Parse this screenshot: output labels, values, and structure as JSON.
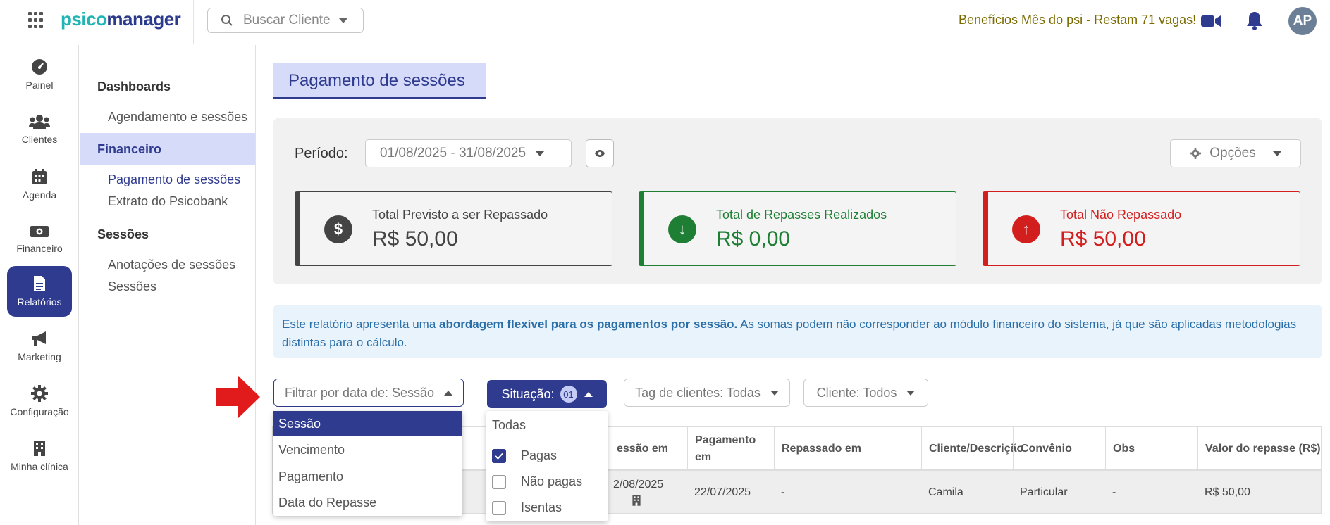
{
  "header": {
    "logo_part1": "psico",
    "logo_part2": "manager",
    "search_placeholder": "Buscar Cliente",
    "promo_text": "Benefícios Mês do psi - Restam 71 vagas!",
    "avatar_initials": "AP"
  },
  "left_nav": {
    "items": [
      {
        "label": "Painel",
        "icon": "gauge-icon"
      },
      {
        "label": "Clientes",
        "icon": "users-icon"
      },
      {
        "label": "Agenda",
        "icon": "calendar-icon"
      },
      {
        "label": "Financeiro",
        "icon": "money-icon"
      },
      {
        "label": "Relatórios",
        "icon": "report-icon"
      },
      {
        "label": "Marketing",
        "icon": "megaphone-icon"
      },
      {
        "label": "Configuração",
        "icon": "gear-icon"
      },
      {
        "label": "Minha clínica",
        "icon": "building-icon"
      }
    ]
  },
  "sub_nav": {
    "dashboards_heading": "Dashboards",
    "agendamento": "Agendamento e sessões",
    "financeiro_heading": "Financeiro",
    "pagamento": "Pagamento de sessões",
    "extrato": "Extrato do Psicobank",
    "sessoes_heading": "Sessões",
    "anotacoes": "Anotações de sessões",
    "sessoes": "Sessões"
  },
  "page": {
    "title": "Pagamento de sessões",
    "periodo_label": "Período:",
    "periodo_value": "01/08/2025 - 31/08/2025",
    "opcoes_label": "Opções"
  },
  "cards": [
    {
      "label": "Total Previsto a ser Repassado",
      "value": "R$ 50,00",
      "icon_text": "$"
    },
    {
      "label": "Total de Repasses Realizados",
      "value": "R$ 0,00",
      "icon_text": "↓"
    },
    {
      "label": "Total Não Repassado",
      "value": "R$ 50,00",
      "icon_text": "↑"
    }
  ],
  "info": {
    "part1": "Este relatório apresenta uma ",
    "bold": "abordagem flexível para os pagamentos por sessão.",
    "part2": " As somas podem não corresponder ao módulo financeiro do sistema, já que são aplicadas metodologias distintas para o cálculo."
  },
  "filters": {
    "filtrar": "Filtrar por data de: Sessão",
    "situacao": "Situação:",
    "situacao_count": "01",
    "tag": "Tag de clientes: Todas",
    "cliente": "Cliente: Todos"
  },
  "dropdown_data": {
    "options": [
      "Sessão",
      "Vencimento",
      "Pagamento",
      "Data do Repasse"
    ],
    "selected": "Sessão"
  },
  "dropdown_situacao": {
    "todas": "Todas",
    "options": [
      {
        "label": "Pagas",
        "checked": true
      },
      {
        "label": "Não pagas",
        "checked": false
      },
      {
        "label": "Isentas",
        "checked": false
      }
    ]
  },
  "table": {
    "headers": [
      "essão em",
      "Pagamento em",
      "Repassado em",
      "Cliente/Descrição",
      "Convênio",
      "Obs",
      "Valor do repasse (R$)"
    ],
    "rows": [
      {
        "sessao": "2/08/2025",
        "pagamento": "22/07/2025",
        "repassado": "-",
        "cliente": "Camila",
        "convenio": "Particular",
        "obs": "-",
        "valor": "R$ 50,00"
      }
    ]
  },
  "colors": {
    "primary": "#2f3b8f",
    "teal": "#1fb5b5",
    "green": "#1e7e34",
    "red": "#d31e1e",
    "promo": "#7a6a00"
  }
}
